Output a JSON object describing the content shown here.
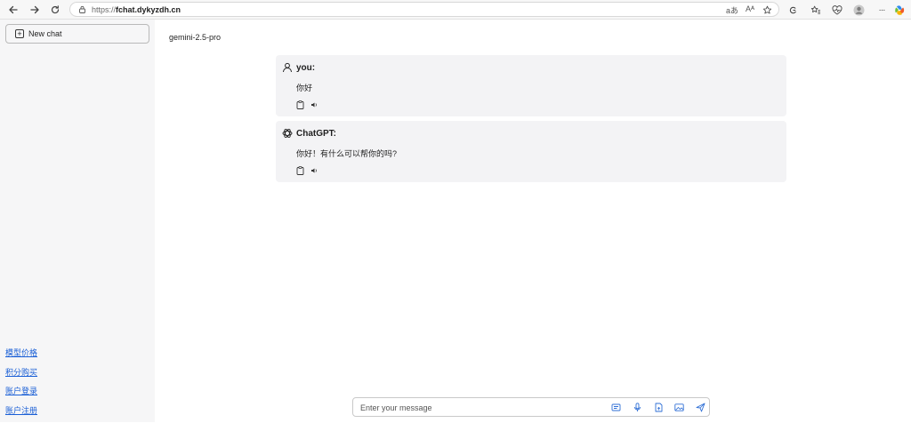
{
  "browser": {
    "url_protocol": "https://",
    "url_host": "fchat.dykyzdh.cn",
    "translate_glyph": "aあ",
    "read_aloud_glyph": "Aᴬ",
    "more_glyph": "···"
  },
  "sidebar": {
    "new_chat_label": "New chat",
    "links": [
      {
        "label": "模型价格"
      },
      {
        "label": "积分购买"
      },
      {
        "label": "账户登录"
      },
      {
        "label": "账户注册"
      }
    ]
  },
  "main": {
    "model_name": "gemini-2.5-pro",
    "messages": [
      {
        "sender": "you:",
        "text": "你好"
      },
      {
        "sender": "ChatGPT:",
        "text": "你好！有什么可以帮你的吗?"
      }
    ]
  },
  "input": {
    "placeholder": "Enter your message",
    "value": ""
  },
  "colors": {
    "link": "#1a5fd6",
    "accent_icon": "#2f6fd6",
    "message_bg": "#f3f3f5",
    "sidebar_bg": "#f6f6f7"
  },
  "icons": {
    "browser": [
      "back-icon",
      "forward-icon",
      "refresh-icon",
      "lock-icon",
      "translate-icon",
      "read-aloud-icon",
      "favorite-star-icon",
      "extension-icon",
      "favorites-icon",
      "health-icon",
      "profile-icon",
      "more-icon",
      "copilot-icon"
    ],
    "message": [
      "user-icon",
      "openai-icon",
      "copy-icon",
      "speak-icon"
    ],
    "input": [
      "prompt-icon",
      "microphone-icon",
      "file-upload-icon",
      "image-upload-icon",
      "send-icon"
    ]
  }
}
